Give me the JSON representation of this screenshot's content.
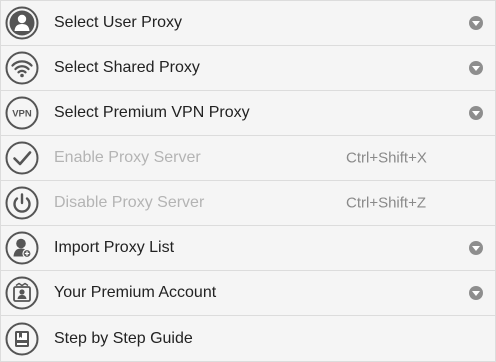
{
  "menu": {
    "items": [
      {
        "label": "Select User Proxy",
        "icon": "user-icon",
        "has_submenu": true,
        "enabled": true
      },
      {
        "label": "Select Shared Proxy",
        "icon": "wifi-icon",
        "has_submenu": true,
        "enabled": true
      },
      {
        "label": "Select Premium VPN Proxy",
        "icon": "vpn-icon",
        "icon_text": "VPN",
        "has_submenu": true,
        "enabled": true
      },
      {
        "label": "Enable Proxy Server",
        "icon": "checkmark-icon",
        "shortcut": "Ctrl+Shift+X",
        "enabled": false
      },
      {
        "label": "Disable Proxy Server",
        "icon": "power-icon",
        "shortcut": "Ctrl+Shift+Z",
        "enabled": false
      },
      {
        "label": "Import Proxy List",
        "icon": "import-user-icon",
        "has_submenu": true,
        "enabled": true
      },
      {
        "label": "Your Premium Account",
        "icon": "premium-account-icon",
        "has_submenu": true,
        "enabled": true
      },
      {
        "label": "Step by Step Guide",
        "icon": "guide-book-icon",
        "enabled": true
      }
    ]
  },
  "colors": {
    "text": "#222222",
    "disabled_text": "#b4b4b4",
    "icon": "#555555",
    "chevron": "#8e8e8e",
    "divider": "#dcdcdc",
    "background": "#f5f5f5"
  }
}
